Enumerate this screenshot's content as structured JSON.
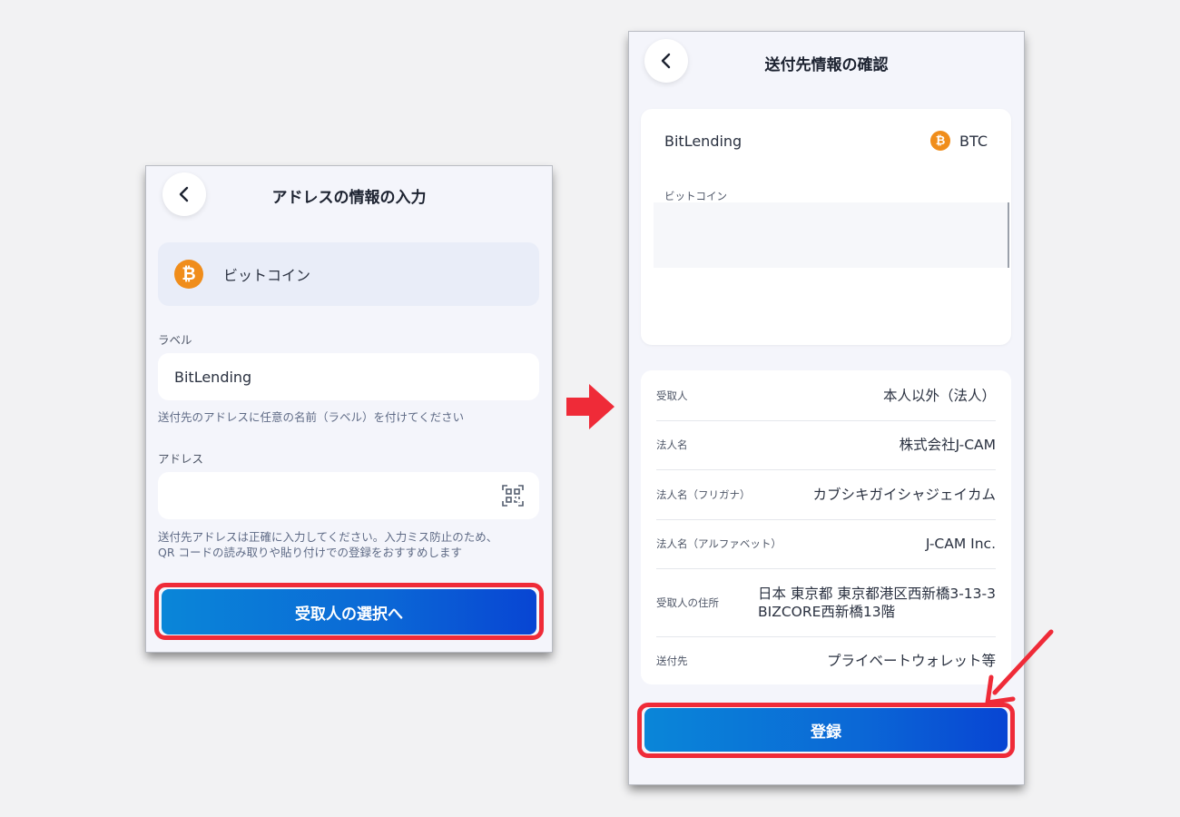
{
  "left_screen": {
    "title": "アドレスの情報の入力",
    "coin": {
      "icon": "bitcoin-icon",
      "symbol": "₿",
      "name": "ビットコイン"
    },
    "label_field": {
      "label": "ラベル",
      "value": "BitLending",
      "hint": "送付先のアドレスに任意の名前（ラベル）を付けてください"
    },
    "address_field": {
      "label": "アドレス",
      "value": "",
      "hint_line1": "送付先アドレスは正確に入力してください。入力ミス防止のため、",
      "hint_line2": "QR コードの読み取りや貼り付けでの登録をおすすめします",
      "icon": "qr-scan-icon"
    },
    "next_button": "受取人の選択へ"
  },
  "right_screen": {
    "title": "送付先情報の確認",
    "card": {
      "label_name": "BitLending",
      "currency_symbol": "₿",
      "currency_code": "BTC",
      "coin_name": "ビットコイン"
    },
    "details": [
      {
        "label": "受取人",
        "value": "本人以外（法人）"
      },
      {
        "label": "法人名",
        "value": "株式会社J-CAM"
      },
      {
        "label": "法人名（フリガナ）",
        "value": "カブシキガイシャジェイカム"
      },
      {
        "label": "法人名（アルファベット）",
        "value": "J-CAM Inc."
      },
      {
        "label": "受取人の住所",
        "value_line1": "日本 東京都 東京都港区西新橋3-13-3",
        "value_line2": "BIZCORE西新橋13階"
      },
      {
        "label": "送付先",
        "value": "プライベートウォレット等"
      }
    ],
    "register_button": "登録"
  },
  "colors": {
    "accent_red": "#ef2b38",
    "button_blue_start": "#0a86d8",
    "button_blue_end": "#0845d3",
    "bitcoin_orange": "#f08d1b"
  }
}
